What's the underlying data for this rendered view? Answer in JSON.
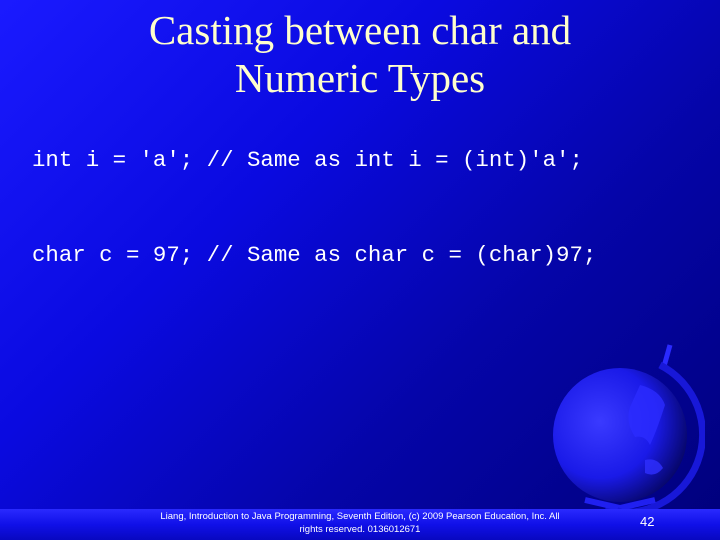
{
  "slide": {
    "title_line1": "Casting between char and",
    "title_line2": "Numeric Types",
    "code_lines": [
      "int i = 'a'; // Same as int i = (int)'a';",
      "char c = 97; // Same as char c = (char)97;"
    ],
    "footer_line1": "Liang, Introduction to Java Programming, Seventh Edition, (c) 2009 Pearson Education, Inc. All",
    "footer_line2": "rights reserved. 0136012671",
    "page_number": "42",
    "decoration_icon": "globe-icon"
  }
}
